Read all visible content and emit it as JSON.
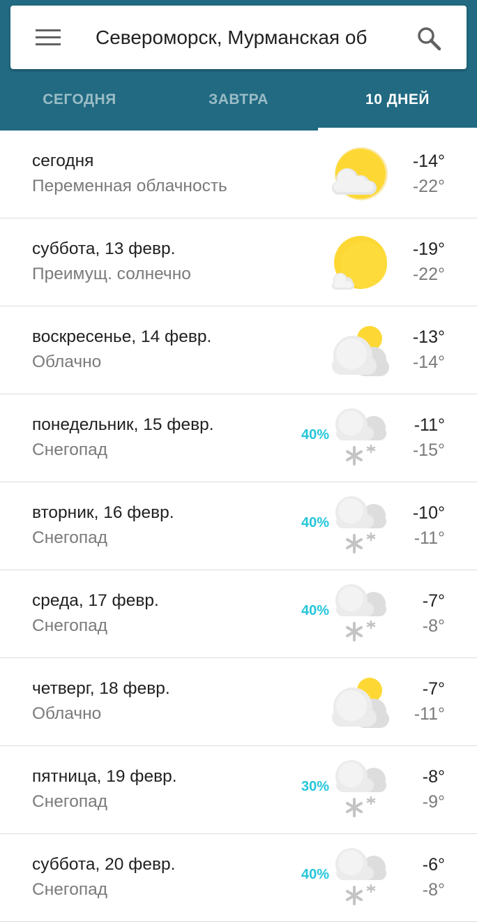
{
  "search": {
    "location": "Североморск, Мурманская об"
  },
  "icons": {
    "menu": "menu-icon",
    "search": "search-icon"
  },
  "colors": {
    "header_bg": "#216a82",
    "active_tab": "#ffffff",
    "precip": "#26c6da",
    "sun": "#fdd835",
    "cloud": "#e8e8e8"
  },
  "tabs": [
    {
      "label": "СЕГОДНЯ",
      "active": false
    },
    {
      "label": "ЗАВТРА",
      "active": false
    },
    {
      "label": "10 ДНЕЙ",
      "active": true
    }
  ],
  "forecast": [
    {
      "day": "сегодня",
      "condition": "Переменная облачность",
      "precip": "",
      "icon": "partly-cloudy-icon",
      "high": "-14°",
      "low": "-22°"
    },
    {
      "day": "суббота, 13 февр.",
      "condition": "Преимущ. солнечно",
      "precip": "",
      "icon": "mostly-sunny-icon",
      "high": "-19°",
      "low": "-22°"
    },
    {
      "day": "воскресенье, 14 февр.",
      "condition": "Облачно",
      "precip": "",
      "icon": "cloudy-icon",
      "high": "-13°",
      "low": "-14°"
    },
    {
      "day": "понедельник, 15 февр.",
      "condition": "Снегопад",
      "precip": "40%",
      "icon": "snow-icon",
      "high": "-11°",
      "low": "-15°"
    },
    {
      "day": "вторник, 16 февр.",
      "condition": "Снегопад",
      "precip": "40%",
      "icon": "snow-icon",
      "high": "-10°",
      "low": "-11°"
    },
    {
      "day": "среда, 17 февр.",
      "condition": "Снегопад",
      "precip": "40%",
      "icon": "snow-icon",
      "high": "-7°",
      "low": "-8°"
    },
    {
      "day": "четверг, 18 февр.",
      "condition": "Облачно",
      "precip": "",
      "icon": "cloudy-icon",
      "high": "-7°",
      "low": "-11°"
    },
    {
      "day": "пятница, 19 февр.",
      "condition": "Снегопад",
      "precip": "30%",
      "icon": "snow-icon",
      "high": "-8°",
      "low": "-9°"
    },
    {
      "day": "суббота, 20 февр.",
      "condition": "Снегопад",
      "precip": "40%",
      "icon": "snow-icon",
      "high": "-6°",
      "low": "-8°"
    }
  ]
}
